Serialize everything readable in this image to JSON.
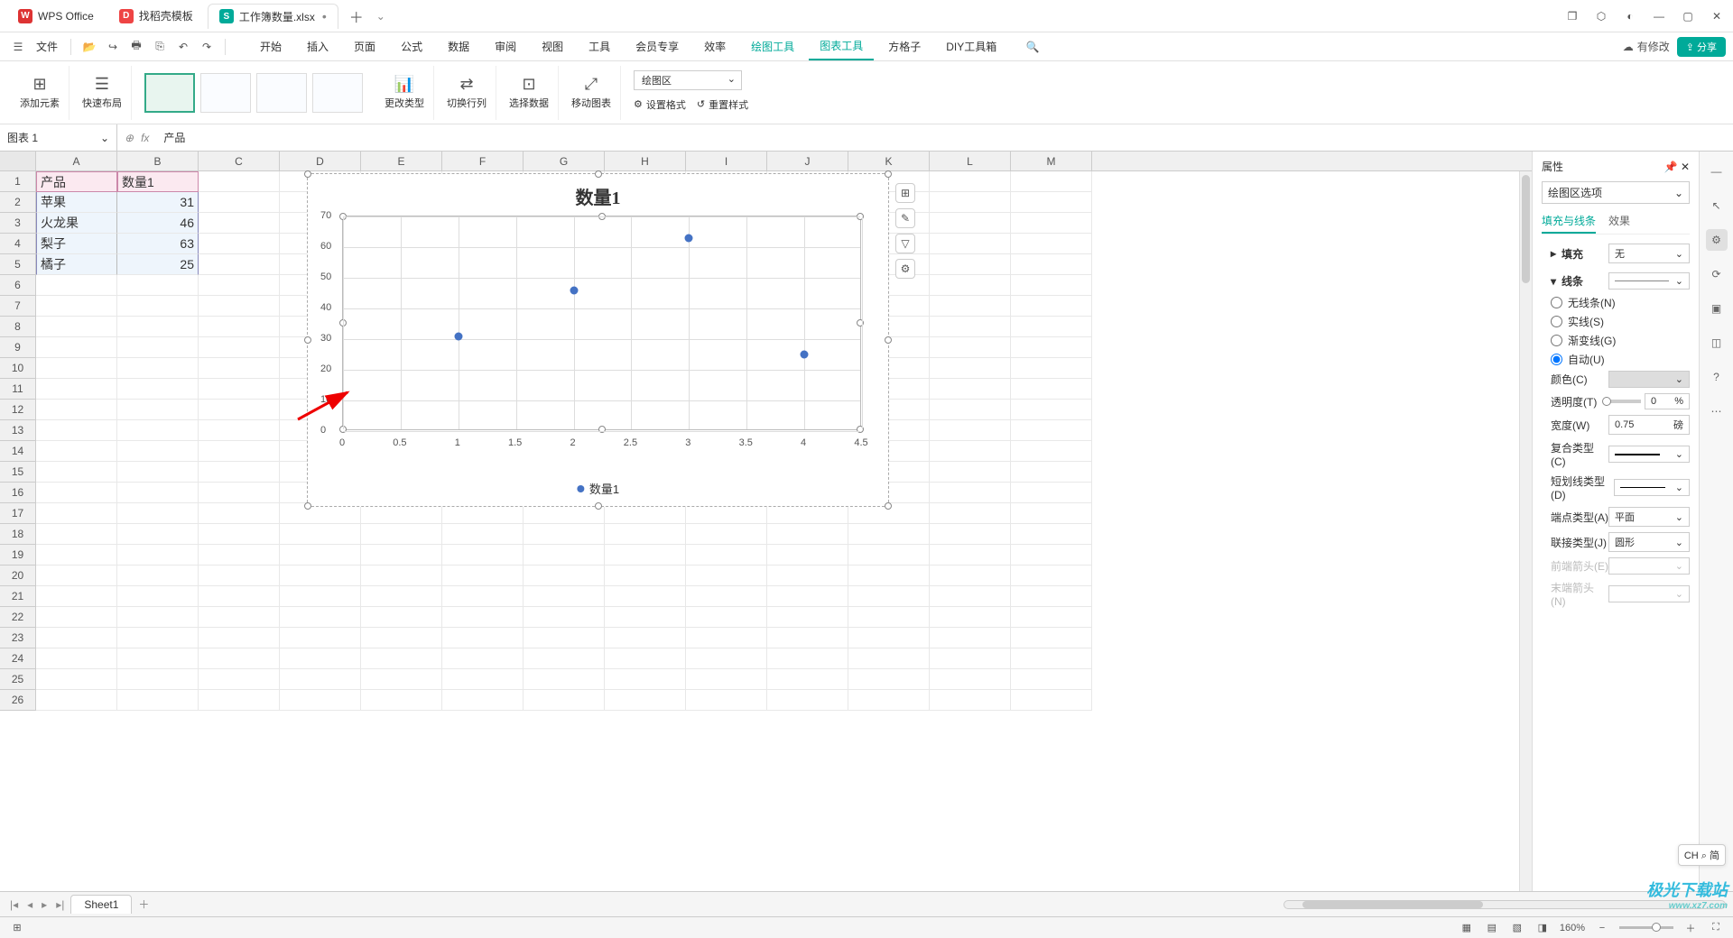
{
  "titlebar": {
    "tabs": [
      {
        "icon_bg": "#d33",
        "icon_text": "W",
        "label": "WPS Office"
      },
      {
        "icon_bg": "#e44",
        "icon_text": "D",
        "label": "找稻壳模板"
      },
      {
        "icon_bg": "#0a9",
        "icon_text": "S",
        "label": "工作簿数量.xlsx"
      }
    ],
    "window_icons": [
      "▢",
      "⬡",
      "◐",
      "—",
      "▢",
      "✕"
    ]
  },
  "menubar": {
    "file": "文件",
    "quick_icons": [
      "📂",
      "↩",
      "🖶",
      "⎘",
      "⤺",
      "⤻"
    ],
    "tabs": [
      "开始",
      "插入",
      "页面",
      "公式",
      "数据",
      "审阅",
      "视图",
      "工具",
      "会员专享",
      "效率",
      "绘图工具",
      "图表工具",
      "方格子",
      "DIY工具箱"
    ],
    "active_tab": "图表工具",
    "green_tabs": [
      "绘图工具",
      "图表工具"
    ],
    "search_icon": "🔍",
    "modify": "有修改",
    "share": "分享"
  },
  "ribbon": {
    "add_element": "添加元素",
    "quick_layout": "快速布局",
    "change_type": "更改类型",
    "switch_rc": "切换行列",
    "select_data": "选择数据",
    "move_chart": "移动图表",
    "area_select": "绘图区",
    "set_format": "设置格式",
    "reset_style": "重置样式"
  },
  "formula": {
    "namebox": "图表 1",
    "fx": "fx",
    "value": "产品"
  },
  "columns": [
    "A",
    "B",
    "C",
    "D",
    "E",
    "F",
    "G",
    "H",
    "I",
    "J",
    "K",
    "L",
    "M"
  ],
  "cells": {
    "A1": "产品",
    "B1": "数量1",
    "A2": "苹果",
    "B2": "31",
    "A3": "火龙果",
    "B3": "46",
    "A4": "梨子",
    "B4": "63",
    "A5": "橘子",
    "B5": "25"
  },
  "chart_data": {
    "type": "scatter",
    "title": "数量1",
    "x": [
      1,
      2,
      3,
      4
    ],
    "y": [
      31,
      46,
      63,
      25
    ],
    "xlim": [
      0,
      4.5
    ],
    "ylim": [
      0,
      70
    ],
    "yticks": [
      0,
      10,
      20,
      30,
      40,
      50,
      60,
      70
    ],
    "xticks": [
      0,
      0.5,
      1,
      1.5,
      2,
      2.5,
      3,
      3.5,
      4,
      4.5
    ],
    "legend": "数量1"
  },
  "side_buttons": [
    "⊞",
    "✎",
    "▽",
    "⚙"
  ],
  "panel": {
    "title": "属性",
    "area_select": "绘图区选项",
    "tab_fill": "填充与线条",
    "tab_effect": "效果",
    "fill_hdr": "填充",
    "fill_value": "无",
    "line_hdr": "线条",
    "line_none": "无线条(N)",
    "line_solid": "实线(S)",
    "line_grad": "渐变线(G)",
    "line_auto": "自动(U)",
    "color": "颜色(C)",
    "opacity": "透明度(T)",
    "opacity_val": "0",
    "opacity_unit": "%",
    "width": "宽度(W)",
    "width_val": "0.75",
    "width_unit": "磅",
    "compound": "复合类型(C)",
    "dash": "短划线类型(D)",
    "cap": "端点类型(A)",
    "cap_val": "平面",
    "join": "联接类型(J)",
    "join_val": "圆形",
    "arrow_start": "前端箭头(E)",
    "arrow_end": "末端箭头(N)"
  },
  "sheet_tabs": {
    "name": "Sheet1"
  },
  "statusbar": {
    "zoom": "160%",
    "lang": "CH ⌕ 简"
  },
  "watermark": {
    "brand": "极光下载站",
    "url": "www.xz7.com"
  }
}
